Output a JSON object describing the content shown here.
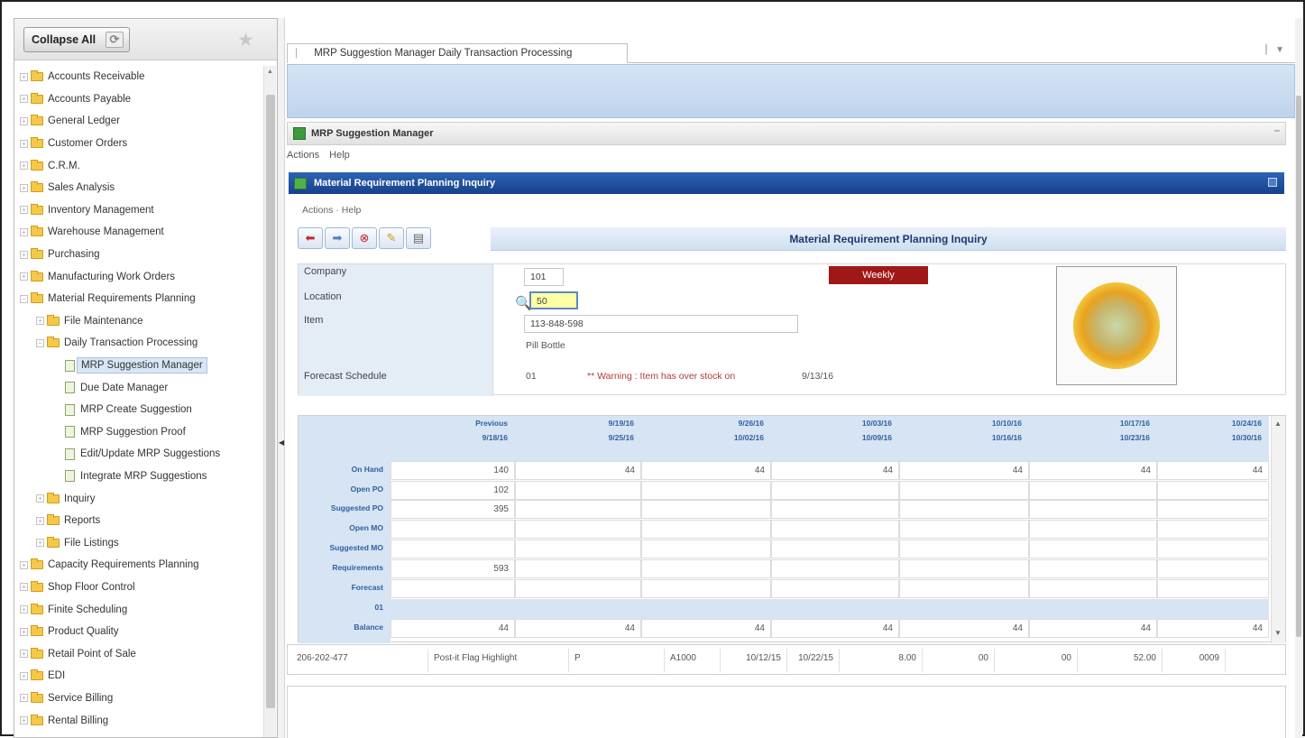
{
  "sidebar": {
    "collapse_label": "Collapse All",
    "items": [
      {
        "label": "Accounts Receivable",
        "level": 0,
        "kind": "folder"
      },
      {
        "label": "Accounts Payable",
        "level": 0,
        "kind": "folder"
      },
      {
        "label": "General Ledger",
        "level": 0,
        "kind": "folder"
      },
      {
        "label": "Customer Orders",
        "level": 0,
        "kind": "folder"
      },
      {
        "label": "C.R.M.",
        "level": 0,
        "kind": "folder"
      },
      {
        "label": "Sales Analysis",
        "level": 0,
        "kind": "folder"
      },
      {
        "label": "Inventory Management",
        "level": 0,
        "kind": "folder"
      },
      {
        "label": "Warehouse Management",
        "level": 0,
        "kind": "folder"
      },
      {
        "label": "Purchasing",
        "level": 0,
        "kind": "folder"
      },
      {
        "label": "Manufacturing Work Orders",
        "level": 0,
        "kind": "folder"
      },
      {
        "label": "Material Requirements Planning",
        "level": 0,
        "kind": "folder-open"
      },
      {
        "label": "File Maintenance",
        "level": 1,
        "kind": "folder"
      },
      {
        "label": "Daily Transaction Processing",
        "level": 1,
        "kind": "folder-open"
      },
      {
        "label": "MRP Suggestion Manager",
        "level": 2,
        "kind": "doc",
        "selected": true
      },
      {
        "label": "Due Date Manager",
        "level": 2,
        "kind": "doc"
      },
      {
        "label": "MRP Create Suggestion",
        "level": 2,
        "kind": "doc"
      },
      {
        "label": "MRP Suggestion Proof",
        "level": 2,
        "kind": "doc"
      },
      {
        "label": "Edit/Update MRP Suggestions",
        "level": 2,
        "kind": "doc"
      },
      {
        "label": "Integrate MRP Suggestions",
        "level": 2,
        "kind": "doc"
      },
      {
        "label": "Inquiry",
        "level": 1,
        "kind": "folder"
      },
      {
        "label": "Reports",
        "level": 1,
        "kind": "folder"
      },
      {
        "label": "File Listings",
        "level": 1,
        "kind": "folder"
      },
      {
        "label": "Capacity Requirements Planning",
        "level": 0,
        "kind": "folder"
      },
      {
        "label": "Shop Floor Control",
        "level": 0,
        "kind": "folder"
      },
      {
        "label": "Finite Scheduling",
        "level": 0,
        "kind": "folder"
      },
      {
        "label": "Product Quality",
        "level": 0,
        "kind": "folder"
      },
      {
        "label": "Retail Point of Sale",
        "level": 0,
        "kind": "folder"
      },
      {
        "label": "EDI",
        "level": 0,
        "kind": "folder"
      },
      {
        "label": "Service Billing",
        "level": 0,
        "kind": "folder"
      },
      {
        "label": "Rental Billing",
        "level": 0,
        "kind": "folder"
      }
    ]
  },
  "tab": {
    "label": "MRP Suggestion Manager Daily Transaction Processing"
  },
  "window": {
    "title": "MRP Suggestion Manager",
    "menu": [
      "Actions",
      "Help"
    ]
  },
  "inquiry": {
    "header": "Material Requirement Planning Inquiry",
    "menu": [
      "Actions",
      "Help"
    ],
    "title": "Material Requirement Planning Inquiry",
    "toolbar_icons": [
      "back-arrow-icon",
      "forward-arrow-icon",
      "cancel-icon",
      "edit-pencil-icon",
      "notes-icon"
    ]
  },
  "form": {
    "company_label": "Company",
    "company_value": "101",
    "location_label": "Location",
    "location_value": "50",
    "item_label": "Item",
    "item_value": "113-848-598",
    "item_desc": "Pill Bottle",
    "forecast_label": "Forecast Schedule",
    "forecast_value": "01",
    "warning": "** Warning : Item has over stock on",
    "warning_date": "9/13/16",
    "period_badge": "Weekly"
  },
  "grid": {
    "columns": [
      {
        "start": "Previous",
        "end": "9/18/16"
      },
      {
        "start": "9/19/16",
        "end": "9/25/16"
      },
      {
        "start": "9/26/16",
        "end": "10/02/16"
      },
      {
        "start": "10/03/16",
        "end": "10/09/16"
      },
      {
        "start": "10/10/16",
        "end": "10/16/16"
      },
      {
        "start": "10/17/16",
        "end": "10/23/16"
      },
      {
        "start": "10/24/16",
        "end": "10/30/16"
      }
    ],
    "rows": [
      {
        "label": "On Hand",
        "values": [
          "140",
          "44",
          "44",
          "44",
          "44",
          "44",
          "44"
        ]
      },
      {
        "label": "Open PO",
        "values": [
          "102",
          "",
          "",
          "",
          "",
          "",
          ""
        ]
      },
      {
        "label": "Suggested PO",
        "values": [
          "395",
          "",
          "",
          "",
          "",
          "",
          ""
        ]
      },
      {
        "label": "Open MO",
        "values": [
          "",
          "",
          "",
          "",
          "",
          "",
          ""
        ]
      },
      {
        "label": "Suggested MO",
        "values": [
          "",
          "",
          "",
          "",
          "",
          "",
          ""
        ]
      },
      {
        "label": "Requirements",
        "values": [
          "593",
          "",
          "",
          "",
          "",
          "",
          ""
        ]
      },
      {
        "label": "Forecast",
        "values": [
          "",
          "",
          "",
          "",
          "",
          "",
          ""
        ]
      },
      {
        "label": "01",
        "values": null
      },
      {
        "label": "Balance",
        "values": [
          "44",
          "44",
          "44",
          "44",
          "44",
          "44",
          "44"
        ]
      }
    ]
  },
  "detail": [
    "206-202-477",
    "Post-it Flag Highlight",
    "P",
    "A1000",
    "10/12/15",
    "10/22/15",
    "8.00",
    "00",
    "00",
    "52.00",
    "0009"
  ],
  "colors": {
    "accent": "#1d4a98",
    "badge": "#a01717",
    "label_bg": "#d7e4f3"
  }
}
